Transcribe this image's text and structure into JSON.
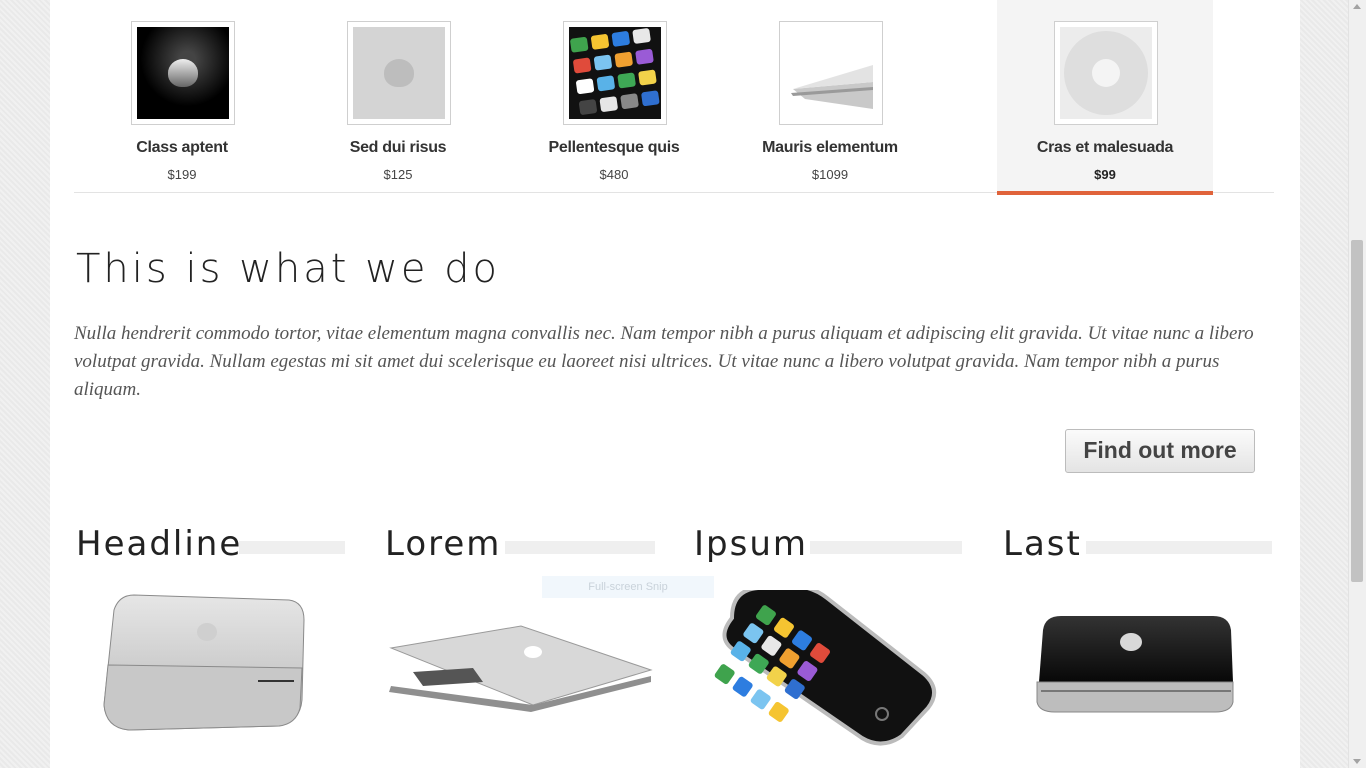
{
  "products": [
    {
      "name": "Class aptent",
      "price": "$199",
      "icon": "apple-dark-icon"
    },
    {
      "name": "Sed dui risus",
      "price": "$125",
      "icon": "apple-grey-icon"
    },
    {
      "name": "Pellentesque quis",
      "price": "$480",
      "icon": "iphone-screen-icon"
    },
    {
      "name": "Mauris elementum",
      "price": "$1099",
      "icon": "laptop-icon"
    },
    {
      "name": "Cras et malesuada",
      "price": "$99",
      "icon": "ipod-wheel-icon"
    }
  ],
  "active_index": 4,
  "section": {
    "title": "This is what we do",
    "lead": "Nulla hendrerit commodo tortor, vitae elementum magna convallis nec. Nam tempor nibh a purus aliquam et adipiscing elit gravida. Ut vitae nunc a libero volutpat gravida. Nullam egestas mi sit amet dui scelerisque eu laoreet nisi ultrices. Ut vitae nunc a libero volutpat gravida. Nam tempor nibh a purus aliquam.",
    "button_label": "Find out more"
  },
  "columns": [
    {
      "title": "Headline",
      "image": "mac-mini-icon"
    },
    {
      "title": "Lorem",
      "image": "macbook-air-icon"
    },
    {
      "title": "Ipsum",
      "image": "iphone-icon"
    },
    {
      "title": "Last",
      "image": "apple-tv-icon"
    }
  ],
  "overlay": {
    "snip_label": "Full-screen Snip"
  },
  "colors": {
    "accent": "#e0633a"
  }
}
